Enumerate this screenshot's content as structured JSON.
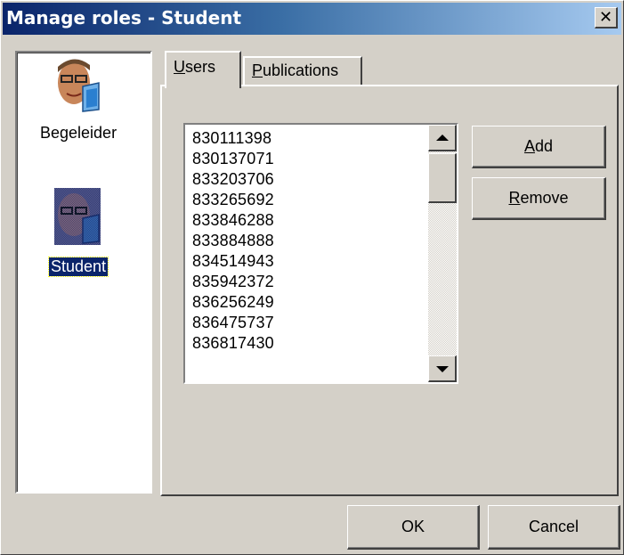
{
  "window": {
    "title": "Manage roles - Student"
  },
  "roles": [
    {
      "label": "Begeleider",
      "icon": "person-icon",
      "selected": false
    },
    {
      "label": "Student",
      "icon": "person-icon",
      "selected": true
    }
  ],
  "tabs": [
    {
      "label_mnemonic": "U",
      "label_rest": "sers",
      "active": true
    },
    {
      "label_mnemonic": "P",
      "label_rest": "ublications",
      "active": false
    }
  ],
  "users": {
    "items": [
      "830111398",
      "830137071",
      "833203706",
      "833265692",
      "833846288",
      "833884888",
      "834514943",
      "835942372",
      "836256249",
      "836475737",
      "836817430"
    ]
  },
  "buttons": {
    "add_mnemonic": "A",
    "add_rest": "dd",
    "remove_mnemonic": "R",
    "remove_rest": "emove",
    "ok": "OK",
    "cancel": "Cancel"
  },
  "colors": {
    "titlebar_start": "#0a246a",
    "titlebar_end": "#a6caf0",
    "face": "#d4d0c8",
    "selection": "#0a246a"
  }
}
